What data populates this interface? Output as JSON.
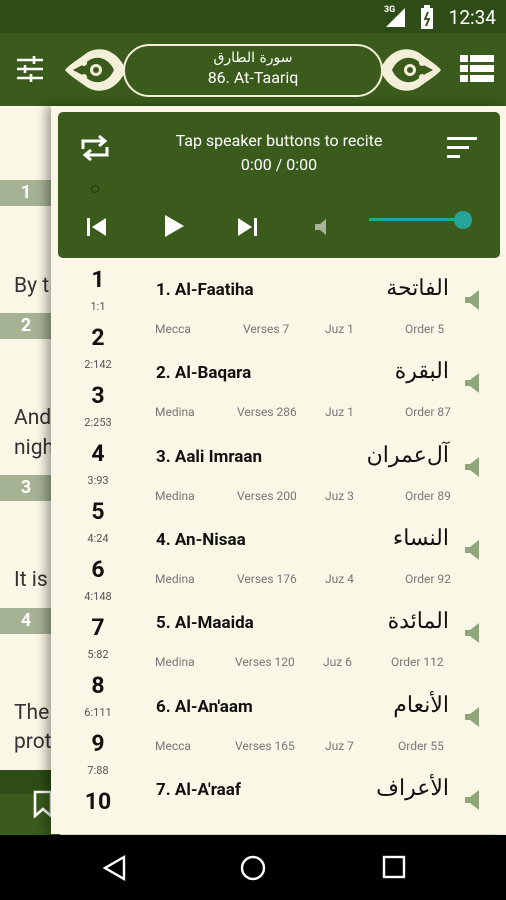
{
  "status": {
    "network": "3G",
    "time": "12:34"
  },
  "toolbar": {
    "title_arabic": "سورة الطارق",
    "title": "86. At-Taariq"
  },
  "player": {
    "hint": "Tap speaker buttons to recite",
    "time": "0:00 / 0:00",
    "volume_fraction": 0.95
  },
  "reader": {
    "verses": [
      {
        "num": "1",
        "text": ""
      },
      {
        "num": "2",
        "text": "By t"
      },
      {
        "num": "3",
        "text": "And night"
      },
      {
        "num": "4",
        "text": "It is"
      },
      {
        "num": "",
        "text": "The protect"
      }
    ],
    "verse_text_1": "By t",
    "verse_text_2a": "And",
    "verse_text_2b": "nigh",
    "verse_text_3": "It is",
    "verse_text_4a": "The",
    "verse_text_4b": "prot"
  },
  "juz_index": [
    {
      "num": "1",
      "ref": "1:1"
    },
    {
      "num": "2",
      "ref": "2:142"
    },
    {
      "num": "3",
      "ref": "2:253"
    },
    {
      "num": "4",
      "ref": "3:93"
    },
    {
      "num": "5",
      "ref": "4:24"
    },
    {
      "num": "6",
      "ref": "4:148"
    },
    {
      "num": "7",
      "ref": "5:82"
    },
    {
      "num": "8",
      "ref": "6:111"
    },
    {
      "num": "9",
      "ref": "7:88"
    },
    {
      "num": "10",
      "ref": ""
    }
  ],
  "surahs": [
    {
      "name": "1. Al-Faatiha",
      "arabic": "الفاتحة",
      "place": "Mecca",
      "verses": "Verses 7",
      "juz": "Juz 1",
      "order": "Order 5"
    },
    {
      "name": "2. Al-Baqara",
      "arabic": "البقرة",
      "place": "Medina",
      "verses": "Verses 286",
      "juz": "Juz 1",
      "order": "Order 87"
    },
    {
      "name": "3. Aali Imraan",
      "arabic": "آل‌عمران",
      "place": "Medina",
      "verses": "Verses 200",
      "juz": "Juz 3",
      "order": "Order 89"
    },
    {
      "name": "4. An-Nisaa",
      "arabic": "النساء",
      "place": "Medina",
      "verses": "Verses 176",
      "juz": "Juz 4",
      "order": "Order 92"
    },
    {
      "name": "5. Al-Maaida",
      "arabic": "المائدة",
      "place": "Medina",
      "verses": "Verses 120",
      "juz": "Juz 6",
      "order": "Order 112"
    },
    {
      "name": "6. Al-An'aam",
      "arabic": "الأنعام",
      "place": "Mecca",
      "verses": "Verses 165",
      "juz": "Juz 7",
      "order": "Order 55"
    },
    {
      "name": "7. Al-A'raaf",
      "arabic": "الأعراف",
      "place": "",
      "verses": "",
      "juz": "",
      "order": ""
    }
  ],
  "colors": {
    "primary": "#3a5b1c",
    "status_bar": "#2e4d16",
    "background": "#fbf7e6",
    "accent": "#26a69a",
    "verse_badge": "#a6b294"
  },
  "icons": [
    "tune-icon",
    "list-icon",
    "repeat-icon",
    "sort-icon",
    "skip-previous-icon",
    "play-icon",
    "skip-next-icon",
    "volume-icon",
    "speaker-icon",
    "bookmark-icon",
    "back-icon",
    "home-icon",
    "recents-icon"
  ]
}
